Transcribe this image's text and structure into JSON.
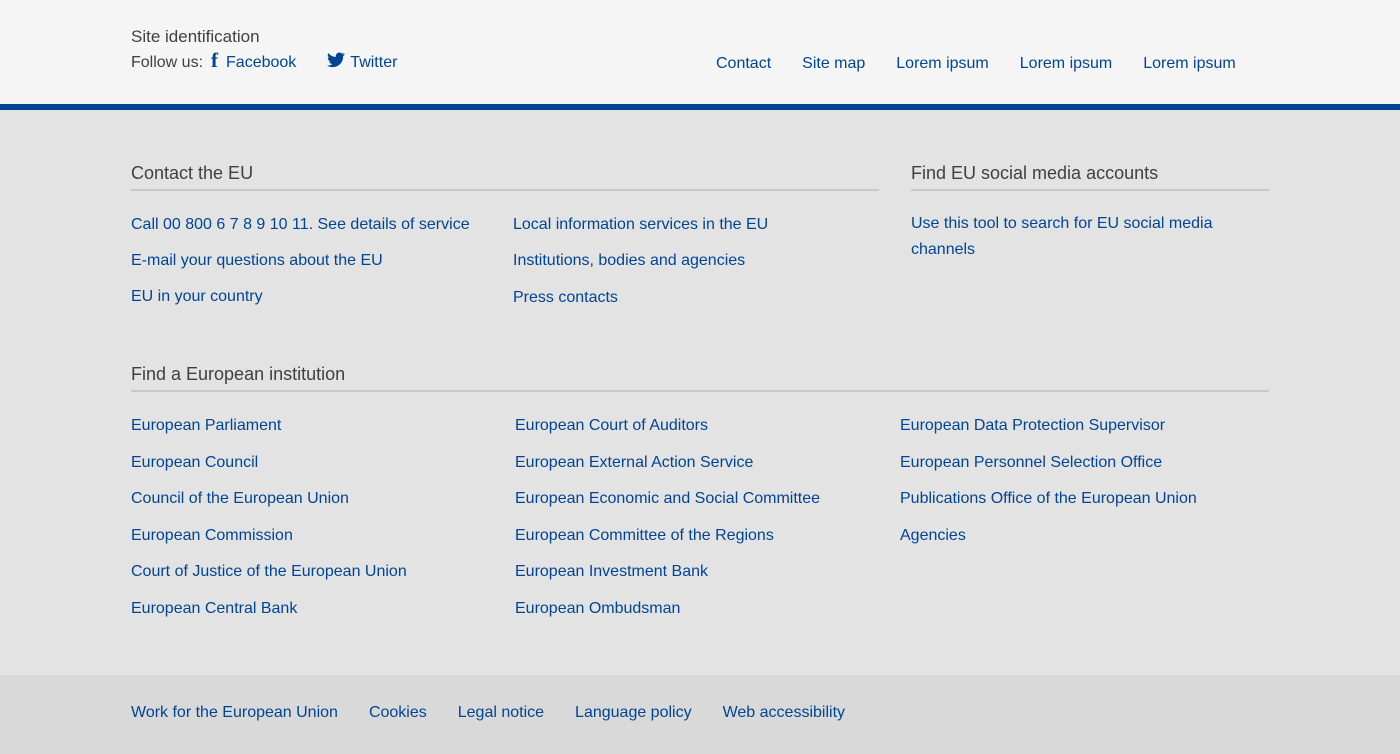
{
  "header": {
    "site_identification": "Site identification",
    "follow_us": "Follow us:",
    "facebook": "Facebook",
    "twitter": "Twitter",
    "links": [
      "Contact",
      "Site map",
      "Lorem ipsum",
      "Lorem ipsum",
      "Lorem ipsum"
    ]
  },
  "contact": {
    "title": "Contact the EU",
    "col1": [
      "Call 00 800 6 7 8 9 10 11. See details of service",
      "E-mail your questions about the EU",
      "EU in your country"
    ],
    "col2": [
      "Local information services in the EU",
      "Institutions, bodies and agencies",
      "Press contacts"
    ]
  },
  "social": {
    "title": "Find EU social media accounts",
    "link": "Use this tool to search for EU social media channels"
  },
  "institutions": {
    "title": "Find a European institution",
    "col1": [
      "European Parliament",
      "European Council",
      "Council of the European Union",
      "European Commission",
      "Court of Justice of the European Union",
      "European Central Bank"
    ],
    "col2": [
      "European Court of Auditors",
      "European External Action Service",
      "European Economic and Social Committee",
      "European Committee of the Regions",
      "European Investment Bank",
      "European Ombudsman"
    ],
    "col3": [
      "European Data Protection Supervisor",
      "European Personnel Selection Office",
      "Publications Office of the European Union",
      "Agencies"
    ]
  },
  "footer": {
    "links": [
      "Work for the European Union",
      "Cookies",
      "Legal notice",
      "Language policy",
      "Web accessibility"
    ]
  },
  "colors": {
    "link": "#004494",
    "accent_bar": "#004494",
    "top_background": "#f5f5f5",
    "main_background": "#e3e3e3",
    "bottom_background": "#d9d9d9"
  }
}
